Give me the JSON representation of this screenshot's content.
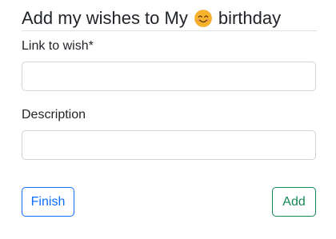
{
  "header": {
    "title_before": "Add my wishes to My",
    "title_after": "birthday",
    "emoji_icon": "smiling-face-emoji"
  },
  "form": {
    "link_label": "Link to wish*",
    "link_value": "",
    "description_label": "Description",
    "description_value": ""
  },
  "actions": {
    "finish_label": "Finish",
    "add_label": "Add"
  },
  "colors": {
    "primary": "#0d6efd",
    "success": "#198754",
    "border": "#ced4da"
  }
}
